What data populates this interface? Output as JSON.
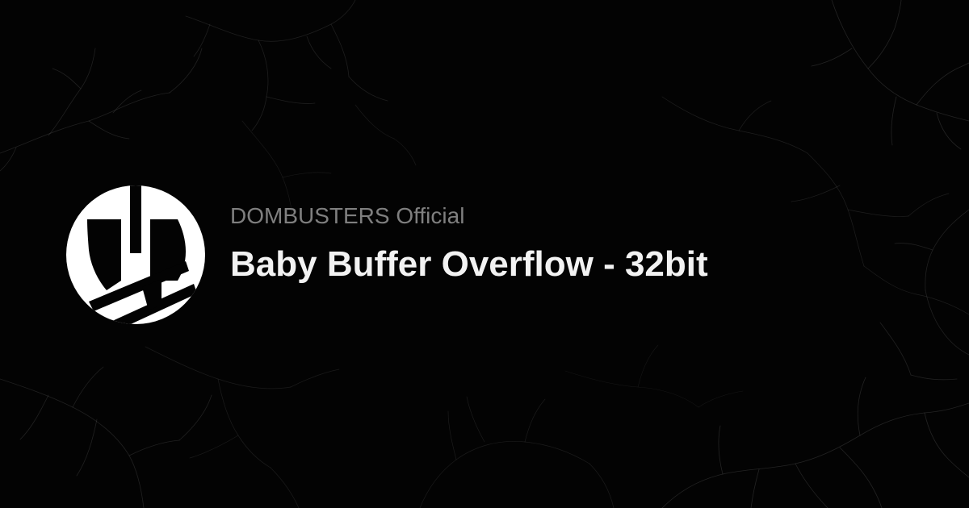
{
  "brand": {
    "name": "DOMBUSTERS Official",
    "logo_icon": "dombusters-logo-icon",
    "logo_color": "#ffffff"
  },
  "post": {
    "title": "Baby Buffer Overflow - 32bit"
  },
  "background": {
    "color": "#030303",
    "texture": "cracked-vein-lines-texture",
    "texture_color": "#8a8a8a"
  },
  "colors": {
    "site_name": "#7f7f7f",
    "title": "#f2f2f2"
  }
}
